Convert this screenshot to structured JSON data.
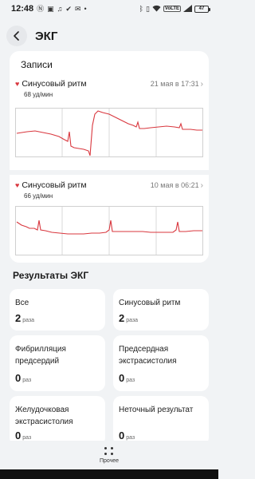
{
  "status_bar": {
    "time": "12:48",
    "left_icons": [
      "N",
      "☐",
      "♪",
      "✓",
      "✉",
      "·"
    ],
    "volte": "VoLTE",
    "battery": "47"
  },
  "header": {
    "title": "ЭКГ"
  },
  "records": {
    "label": "Записи",
    "items": [
      {
        "title": "Синусовый ритм",
        "date": "21 мая в 17:31",
        "rate": "68 уд/мин"
      },
      {
        "title": "Синусовый ритм",
        "date": "10 мая в 06:21",
        "rate": "66 уд/мин"
      }
    ]
  },
  "results": {
    "title": "Результаты ЭКГ",
    "tiles": [
      {
        "label": "Все",
        "value": "2",
        "unit": "раза"
      },
      {
        "label": "Синусовый ритм",
        "value": "2",
        "unit": "раза"
      },
      {
        "label": "Фибрилляция предсердий",
        "value": "0",
        "unit": "раз"
      },
      {
        "label": "Предсердная экстрасистолия",
        "value": "0",
        "unit": "раз"
      },
      {
        "label": "Желудочковая экстрасистолия",
        "value": "0",
        "unit": "раз"
      },
      {
        "label": "Неточный результат",
        "value": "0",
        "unit": "раз"
      }
    ]
  },
  "bottom": {
    "more_label": "Прочее"
  },
  "colors": {
    "accent": "#d9373e",
    "background": "#f1f3f5",
    "card": "#ffffff"
  }
}
